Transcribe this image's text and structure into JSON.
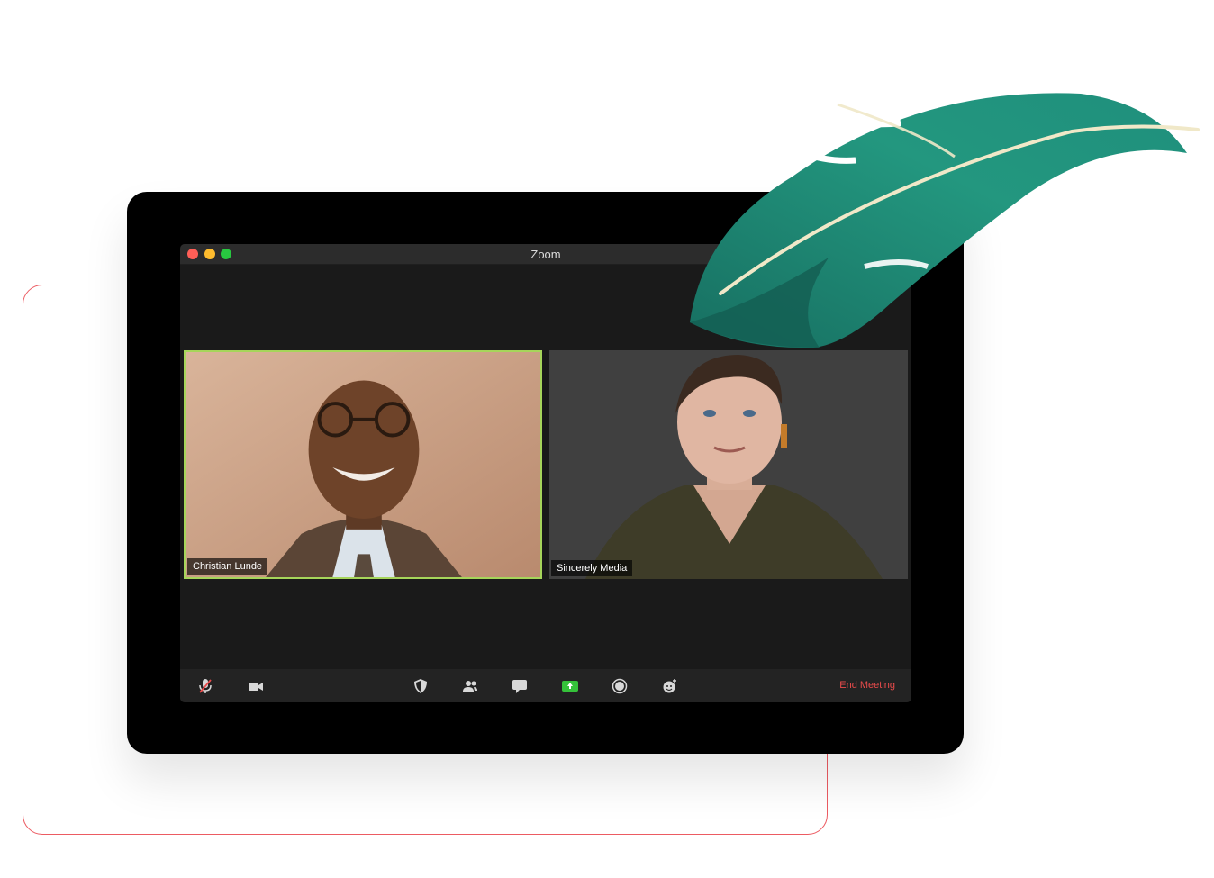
{
  "window": {
    "title": "Zoom",
    "controls": [
      "close",
      "minimize",
      "maximize"
    ]
  },
  "participants": [
    {
      "name": "Christian Lunde",
      "active_speaker": true
    },
    {
      "name": "Sincerely Media",
      "active_speaker": false
    }
  ],
  "toolbar": {
    "left_icons": [
      "microphone-muted-icon",
      "video-camera-icon"
    ],
    "center_icons": [
      "security-shield-icon",
      "participants-icon",
      "chat-icon",
      "share-screen-icon",
      "record-icon",
      "reactions-icon"
    ],
    "end_meeting_label": "End Meeting"
  },
  "colors": {
    "active_speaker_border": "#a6d55a",
    "end_meeting": "#ea4b4b",
    "share_screen": "#35c23a",
    "outline_frame": "#ec5b62",
    "leaf": "#1f8f7c"
  }
}
